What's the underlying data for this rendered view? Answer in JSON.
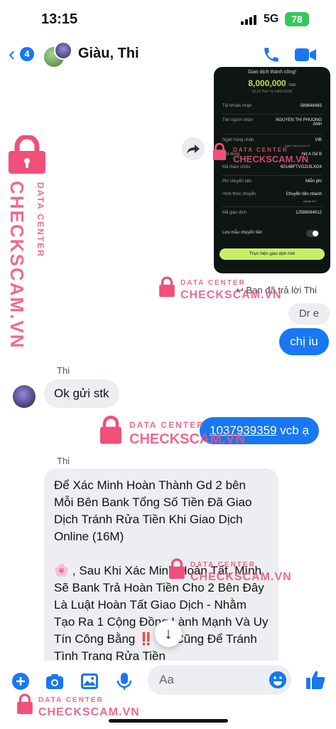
{
  "status_bar": {
    "time": "13:15",
    "network": "5G",
    "battery": "78"
  },
  "header": {
    "unread_count": "4",
    "contact_name": "Giàu, Thi"
  },
  "receipt": {
    "title": "Giao dịch thành công!",
    "amount": "8,000,000",
    "currency": "VND",
    "datetime": "22:23 Thứ Tư 14/01/2026",
    "rows": [
      {
        "label": "Tài khoản nhận",
        "value": "589646493"
      },
      {
        "label": "Tên người nhận",
        "value": "NGUYEN THI PHUONG ANH"
      },
      {
        "label": "Ngân hàng nhận",
        "value": "VIB"
      },
      {
        "label": "Nội dung",
        "value": "Nd A Gd B"
      },
      {
        "label": "Mã tham chiếu",
        "value": "6014BFTVG2UILXG4"
      },
      {
        "label": "Phí chuyển tiền",
        "value": "Miễn phí"
      },
      {
        "label": "Hình thức chuyển",
        "value": "Chuyển tiền nhanh"
      },
      {
        "label": "Mã giao dịch",
        "value": "12588064012"
      }
    ],
    "bank_sub": "Ngân hàng Quốc tế",
    "napas": "napas 247",
    "save_template": "Lưu mẫu chuyển tiền",
    "new_transaction": "Thực hiện giao dịch mới"
  },
  "messages": {
    "reply_note": "Bạn đã trả lời Thi",
    "quoted": "Dr e",
    "out1": "chị iu",
    "sender1": "Thi",
    "in1": "Ok gửi stk",
    "out2_account": "1037939359",
    "out2_rest": " vcb ạ",
    "sender2": "Thi",
    "in2_p1": "Để Xác Minh Hoàn Thành Gd 2 bên Mỗi Bên Bank Tổng Số Tiền Đã Giao Dịch Tránh Rửa Tiền Khi Giao Dịch Online (16M)",
    "in2_p2": "🌸 , Sau Khi Xác Minh Hoàn Tất, Mình Sẽ Bank Trả Hoàn Tiền Cho 2 Bên Đây Là Luật Hoàn Tất Giao Dịch - Nhằm Tạo Ra 1 Cộng Đồng Lành Mạnh Và Uy Tín Công Bằng ‼️ Và Cũng Để Tránh Tình Trạng Rửa Tiền"
  },
  "composer": {
    "placeholder": "Aa"
  },
  "watermark": {
    "line1": "DATA CENTER",
    "line2": "CHECKSCAM.VN"
  },
  "colors": {
    "accent": "#1877f2",
    "watermark": "#f0507a",
    "receipt_bg": "#0f1512",
    "receipt_accent": "#c8ef6a"
  }
}
